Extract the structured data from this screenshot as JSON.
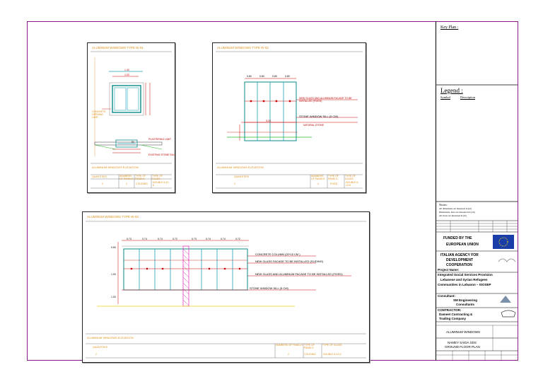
{
  "panels": {
    "w01": {
      "title": "ALUMINUM WINDOWS TYPE W-01",
      "elevation_title": "ALUMINUM WINDOWS ELEVATION",
      "dims": {
        "overall": "1.40",
        "inner": "1.20"
      },
      "labels": {
        "concrete_opening": "CONCRETE OPENING LIMIT",
        "plastering": "PLASTERING LIMIT",
        "stone_sill": "EXISTING STONE SILL",
        "in": "IN"
      },
      "table": {
        "headers": [
          "QUANTITIES",
          "NUMBERS OF PANELS",
          "TYPE OF PANELS",
          "TYPE OF GLASS"
        ],
        "row": [
          "2",
          "2",
          "2 SLIDING",
          "DOUBLE 6-12-6"
        ]
      }
    },
    "w02": {
      "title": "ALUMINUM WINDOWS TYPE W-02",
      "elevation_title": "ALUMINUM WINDOWS ELEVATION",
      "dims": [
        "0.80",
        "0.80",
        "0.80",
        "0.80"
      ],
      "total": "3.20",
      "labels": {
        "glass": "NEW GLASS AND ALUMINUM FACADE TO BE INSTALLED (FIXED)",
        "sill": "STONE WINDOW SILL (5 CM)",
        "natural": "NATURAL STONE"
      },
      "table": {
        "headers": [
          "QUANTITIES",
          "NUMBERS OF PANELS",
          "TYPE OF PANELS",
          "TYPE OF GLASS"
        ],
        "row": [
          "2",
          "4",
          "FIXED",
          "DOUBLE 6-12-6"
        ]
      }
    },
    "w03": {
      "title": "ALUMINUM WINDOWS TYPE W-03",
      "elevation_title": "ALUMINUM WINDOWS ELEVATION",
      "dims": [
        "0.73",
        "0.74",
        "0.74",
        "0.72",
        "0.73",
        "0.74",
        "0.74",
        "0.72"
      ],
      "heights": [
        "0.60",
        "1.00",
        "1.00"
      ],
      "labels": {
        "column": "CONCRETE COLUMN (20*15 CM )",
        "sliding": "NEW GLASS FACADE TO BE INSTALLED (SLIDING)",
        "fixed": "NEW GLASS AND ALUMINUM FACADE TO BE INSTALLED (FIXED)",
        "sill": "STONE WINDOW SILL (5 CM)"
      },
      "table": {
        "headers": [
          "QUANTITIES",
          "NUMBERS OF PANELS",
          "TYPE OF PANELS",
          "TYPE OF GLASS"
        ],
        "row": [
          "2",
          "2",
          "2 SLIDING",
          "DOUBLE 6-12-6"
        ]
      }
    }
  },
  "title_block": {
    "key_plan": "Key Plan :",
    "legend": "Legend :",
    "symbol": "Symbol",
    "description": "Description",
    "notes_heading": "Notes:",
    "notes": [
      "All dimensions are measured in (m)",
      "Dimensions, have are measured in (cm)",
      "All levels are measured in (m)"
    ],
    "funded": [
      "FUNDED BY THE",
      "EUROPEAN UNION"
    ],
    "agency": [
      "ITALIAN AGENCY FOR",
      "DEVELOPMENT",
      "COOPERATION"
    ],
    "project": [
      "Project Name:",
      "Integrated Social Services Provision",
      "Lebanese and Syrian Refugees",
      "Communities in Lebanon – ISOSEP"
    ],
    "consultant": [
      "Consultant:",
      "SM Engineering",
      "Consultants"
    ],
    "contractor": [
      "CONTRACTOR:",
      "Dameet Contracting &",
      "Trading Company"
    ],
    "drawing_title": "ALUMINUM WINDOWS",
    "location": [
      "NAMEY SAIDA SDS",
      "GROUND FLOOR PLAN"
    ]
  },
  "colors": {
    "frame": "#8a1a8a",
    "dimension": "#cc0000",
    "title": "#e0901a",
    "glass": "#1aa3b8",
    "ground": "#2ab52a",
    "column": "#e040c0"
  }
}
